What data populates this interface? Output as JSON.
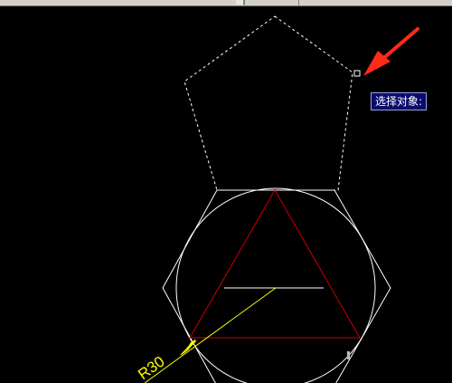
{
  "command_prompt": {
    "text": "选择对象:"
  },
  "dimension": {
    "text": "R30"
  },
  "colors": {
    "background": "#000000",
    "geometry": "#ffffff",
    "triangle": "#cc0000",
    "dimension": "#ffff00",
    "arrow": "#ff2a1a",
    "tooltip_bg": "#0b0b6e"
  },
  "icons": {
    "pointer_arrow": "red-arrow-icon",
    "pick_box": "pickbox-icon"
  }
}
